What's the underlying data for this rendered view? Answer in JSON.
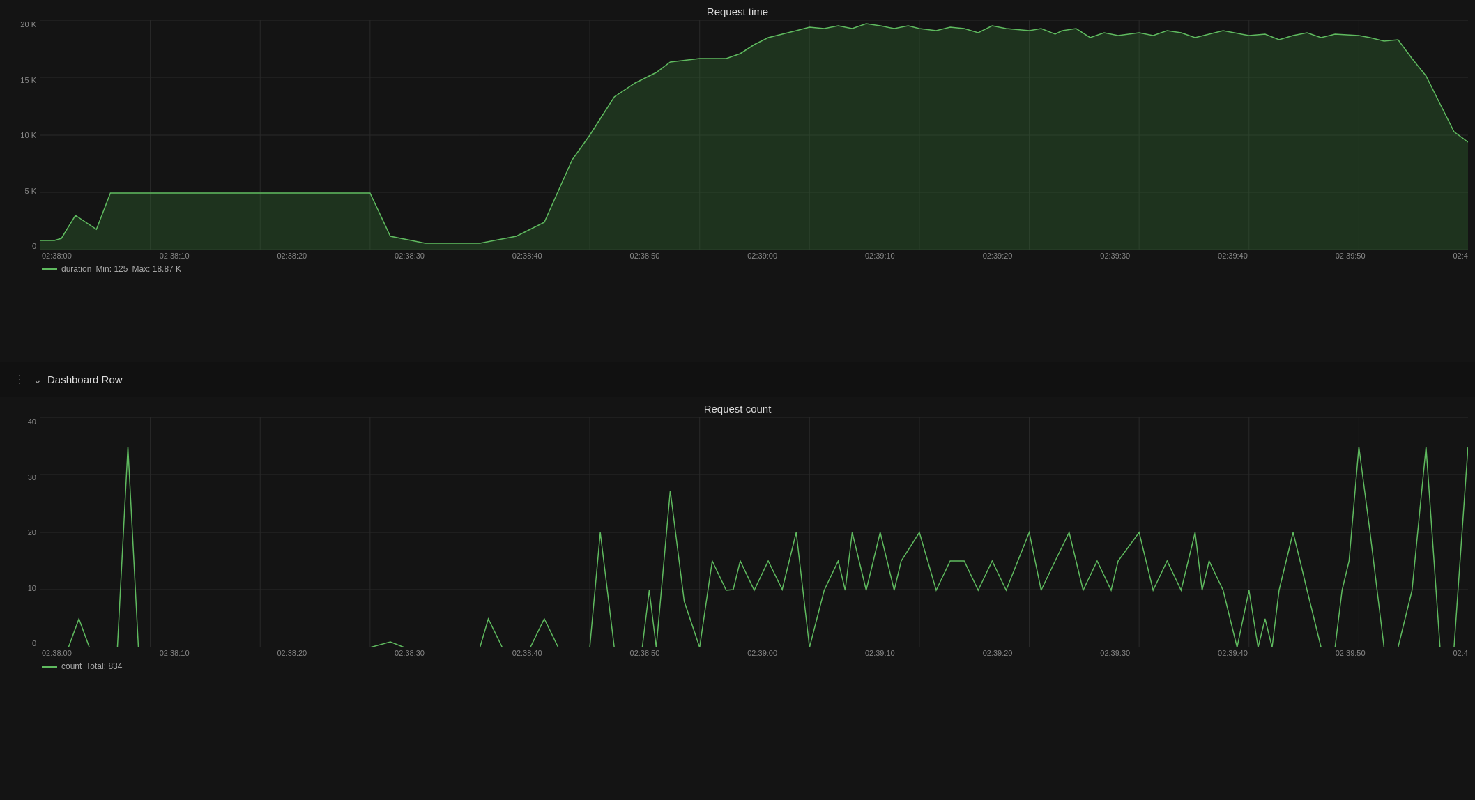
{
  "chart1": {
    "title": "Request time",
    "y_labels": [
      "20 K",
      "15 K",
      "10 K",
      "5 K",
      "0"
    ],
    "x_labels": [
      "02:38:00",
      "02:38:10",
      "02:38:20",
      "02:38:30",
      "02:38:40",
      "02:38:50",
      "02:39:00",
      "02:39:10",
      "02:39:20",
      "02:39:30",
      "02:39:40",
      "02:39:50",
      "02:4"
    ],
    "legend": "duration",
    "legend_min": "Min: 125",
    "legend_max": "Max: 18.87 K"
  },
  "dashboard_row": {
    "title": "Dashboard Row"
  },
  "chart2": {
    "title": "Request count",
    "y_labels": [
      "40",
      "30",
      "20",
      "10",
      "0"
    ],
    "x_labels": [
      "02:38:00",
      "02:38:10",
      "02:38:20",
      "02:38:30",
      "02:38:40",
      "02:38:50",
      "02:39:00",
      "02:39:10",
      "02:39:20",
      "02:39:30",
      "02:39:40",
      "02:39:50",
      "02:4"
    ],
    "legend": "count",
    "legend_total": "Total: 834"
  }
}
